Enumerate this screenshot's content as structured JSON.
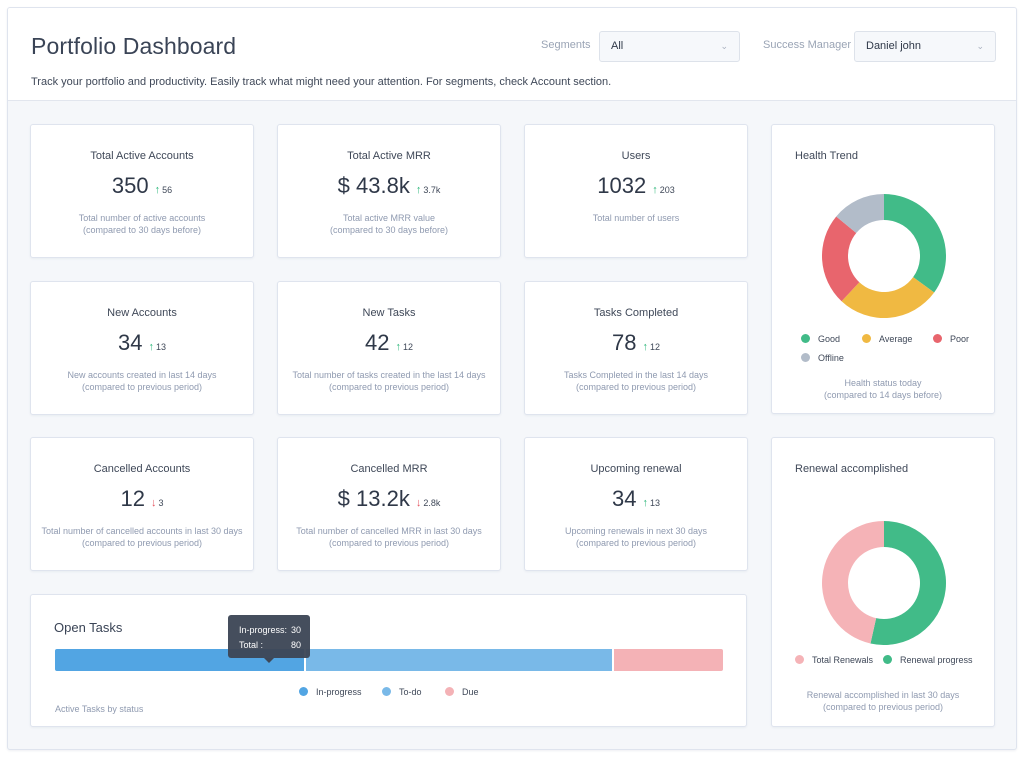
{
  "header": {
    "title": "Portfolio Dashboard",
    "subtitle": "Track your portfolio and productivity. Easily track what might need your attention. For segments, check Account section.",
    "filters": {
      "segments": {
        "label": "Segments",
        "value": "All"
      },
      "success_manager": {
        "label": "Success Manager",
        "value": "Daniel john"
      }
    }
  },
  "stats": [
    {
      "title": "Total Active Accounts",
      "value": "350",
      "delta": "56",
      "direction": "up",
      "desc1": "Total number of active accounts",
      "desc2": "(compared to 30 days before)"
    },
    {
      "title": "Total Active MRR",
      "value": "$ 43.8k",
      "delta": "3.7k",
      "direction": "up",
      "desc1": "Total active MRR value",
      "desc2": "(compared to 30 days before)"
    },
    {
      "title": "Users",
      "value": "1032",
      "delta": "203",
      "direction": "up",
      "desc1": "Total number of users",
      "desc2": ""
    },
    {
      "title": "New Accounts",
      "value": "34",
      "delta": "13",
      "direction": "up",
      "desc1": "New accounts created in last 14 days",
      "desc2": "(compared to previous period)"
    },
    {
      "title": "New Tasks",
      "value": "42",
      "delta": "12",
      "direction": "up",
      "desc1": "Total number of tasks created in the last 14 days",
      "desc2": "(compared to previous period)"
    },
    {
      "title": "Tasks Completed",
      "value": "78",
      "delta": "12",
      "direction": "up",
      "desc1": "Tasks Completed in the last 14 days",
      "desc2": "(compared to previous period)"
    },
    {
      "title": "Cancelled Accounts",
      "value": "12",
      "delta": "3",
      "direction": "down",
      "desc1": "Total number of cancelled accounts in last 30 days",
      "desc2": "(compared to previous period)"
    },
    {
      "title": "Cancelled MRR",
      "value": "$ 13.2k",
      "delta": "2.8k",
      "direction": "down",
      "desc1": "Total number of cancelled MRR in last 30 days",
      "desc2": "(compared to previous period)"
    },
    {
      "title": "Upcoming renewal",
      "value": "34",
      "delta": "13",
      "direction": "up",
      "desc1": "Upcoming renewals in next 30 days",
      "desc2": "(compared to previous period)"
    }
  ],
  "icons": {
    "up": "arrow-up-icon",
    "down": "arrow-down-icon",
    "chevron": "chevron-down-icon"
  },
  "arrow_glyphs": {
    "up": "↑",
    "down": "↓",
    "chevron": "﹀"
  },
  "colors": {
    "good": "#41bb88",
    "average": "#f0b942",
    "poor": "#e8656d",
    "offline": "#b2bcc9",
    "in_progress": "#52a5e3",
    "todo": "#79b9e8",
    "due": "#f4b2b6",
    "total_renewals": "#f5b3b7",
    "renewal_progress": "#41bb88",
    "up": "#2fb87c",
    "down": "#e5545f"
  },
  "health_trend": {
    "title": "Health Trend",
    "foot1": "Health status today",
    "foot2": "(compared to 14 days before)"
  },
  "renewal": {
    "title": "Renewal accomplished",
    "foot1": "Renewal accomplished in last 30 days",
    "foot2": "(compared to previous period)"
  },
  "open_tasks": {
    "title": "Open Tasks",
    "foot": "Active Tasks by status",
    "tooltip": {
      "label1": "In-progress:",
      "value1": "30",
      "label2": "Total :",
      "value2": "80"
    }
  },
  "chart_data": [
    {
      "type": "pie",
      "title": "Health Trend",
      "donut": true,
      "categories": [
        "Good",
        "Average",
        "Poor",
        "Offline"
      ],
      "values": [
        35,
        27,
        24,
        14
      ],
      "unit": "percent (estimated)",
      "legend_position": "bottom"
    },
    {
      "type": "pie",
      "title": "Renewal accomplished",
      "donut": true,
      "categories": [
        "Total Renewals",
        "Renewal progress"
      ],
      "values": [
        46.5,
        53.5
      ],
      "unit": "percent (estimated)",
      "legend_position": "bottom"
    },
    {
      "type": "bar",
      "title": "Open Tasks",
      "stacked": true,
      "orientation": "horizontal",
      "categories": [
        "In-progress",
        "To-do",
        "Due"
      ],
      "values": [
        30,
        37,
        13
      ],
      "total": 80,
      "legend_position": "bottom"
    }
  ]
}
